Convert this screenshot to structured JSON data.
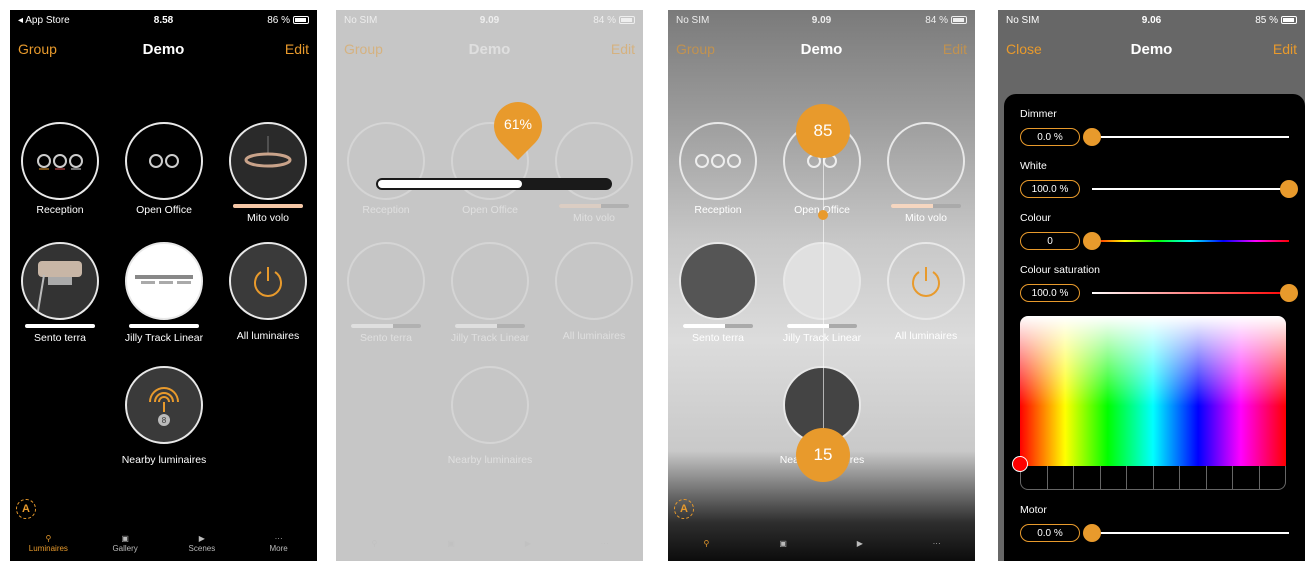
{
  "panels": [
    {
      "status": {
        "carrier": "◂ App Store",
        "time": "8.58",
        "battery": "86 %"
      },
      "nav": {
        "left": "Group",
        "title": "Demo",
        "right": "Edit"
      }
    },
    {
      "status": {
        "carrier": "No SIM",
        "time": "9.09",
        "battery": "84 %"
      },
      "nav": {
        "left": "Group",
        "title": "Demo",
        "right": "Edit"
      },
      "tooltip": "61%"
    },
    {
      "status": {
        "carrier": "No SIM",
        "time": "9.09",
        "battery": "84 %"
      },
      "nav": {
        "left": "Group",
        "title": "Demo",
        "right": "Edit"
      },
      "top_bubble": "85",
      "bottom_bubble": "15"
    },
    {
      "status": {
        "carrier": "No SIM",
        "time": "9.06",
        "battery": "85 %"
      },
      "nav": {
        "left": "Close",
        "title": "Demo",
        "right": "Edit"
      }
    }
  ],
  "luminaires": [
    {
      "label": "Reception"
    },
    {
      "label": "Open Office"
    },
    {
      "label": "Mito volo",
      "level": 0.6
    },
    {
      "label": "Sento terra",
      "level": 0.6
    },
    {
      "label": "Jilly Track Linear",
      "level": 0.6
    },
    {
      "label": "All luminaires"
    },
    {
      "label": "Nearby luminaires",
      "badge": "8"
    }
  ],
  "tabs": [
    "Luminaires",
    "Gallery",
    "Scenes",
    "More"
  ],
  "settings": {
    "dimmer": {
      "label": "Dimmer",
      "value": "0.0 %",
      "position": 0
    },
    "white": {
      "label": "White",
      "value": "100.0 %",
      "position": 1
    },
    "colour": {
      "label": "Colour",
      "value": "0",
      "position": 0
    },
    "saturation": {
      "label": "Colour saturation",
      "value": "100.0 %",
      "position": 1
    },
    "motor": {
      "label": "Motor",
      "value": "0.0 %",
      "position": 0
    }
  },
  "colors": {
    "accent": "#e89a2c"
  }
}
